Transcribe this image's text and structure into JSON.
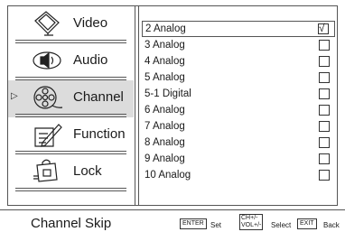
{
  "sidebar": {
    "items": [
      {
        "label": "Video",
        "icon": "video-icon",
        "selected": false
      },
      {
        "label": "Audio",
        "icon": "audio-icon",
        "selected": false
      },
      {
        "label": "Channel",
        "icon": "channel-icon",
        "selected": true
      },
      {
        "label": "Function",
        "icon": "function-icon",
        "selected": false
      },
      {
        "label": "Lock",
        "icon": "lock-icon",
        "selected": false
      }
    ],
    "selection_arrow": "▷"
  },
  "channels": [
    {
      "label": "2 Analog",
      "skip": true,
      "selected": true
    },
    {
      "label": "3 Analog",
      "skip": false
    },
    {
      "label": "4 Analog",
      "skip": false
    },
    {
      "label": "5 Analog",
      "skip": false
    },
    {
      "label": "5-1 Digital",
      "skip": false
    },
    {
      "label": "6 Analog",
      "skip": false
    },
    {
      "label": "7 Analog",
      "skip": false
    },
    {
      "label": "8 Analog",
      "skip": false
    },
    {
      "label": "9 Analog",
      "skip": false
    },
    {
      "label": "10 Analog",
      "skip": false
    }
  ],
  "checkmark": "√",
  "footer": {
    "title": "Channel Skip",
    "enter_key": "ENTER",
    "enter_hint": "Set",
    "chvol_key_line1": "CH+/-",
    "chvol_key_line2": "VOL+/-",
    "select_hint": "Select",
    "exit_key": "EXIT",
    "exit_hint": "Back"
  }
}
